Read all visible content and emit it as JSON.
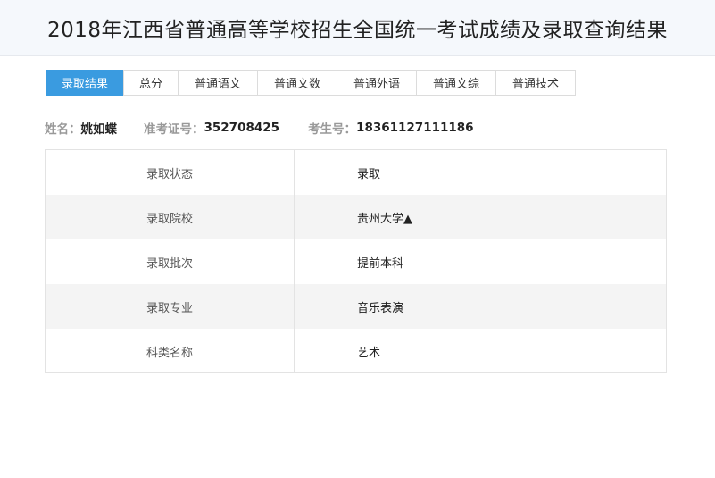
{
  "header": {
    "title": "2018年江西省普通高等学校招生全国统一考试成绩及录取查询结果"
  },
  "tabs": [
    {
      "label": "录取结果"
    },
    {
      "label": "总分"
    },
    {
      "label": "普通语文"
    },
    {
      "label": "普通文数"
    },
    {
      "label": "普通外语"
    },
    {
      "label": "普通文综"
    },
    {
      "label": "普通技术"
    }
  ],
  "info": {
    "name_label": "姓名：",
    "name_value": "姚如蝶",
    "ticket_label": "准考证号：",
    "ticket_value": "352708425",
    "exam_label": "考生号：",
    "exam_value": "18361127111186"
  },
  "table": {
    "rows": [
      {
        "key": "录取状态",
        "value": "录取"
      },
      {
        "key": "录取院校",
        "value": "贵州大学▲"
      },
      {
        "key": "录取批次",
        "value": "提前本科"
      },
      {
        "key": "录取专业",
        "value": "音乐表演"
      },
      {
        "key": "科类名称",
        "value": "艺术"
      }
    ]
  }
}
